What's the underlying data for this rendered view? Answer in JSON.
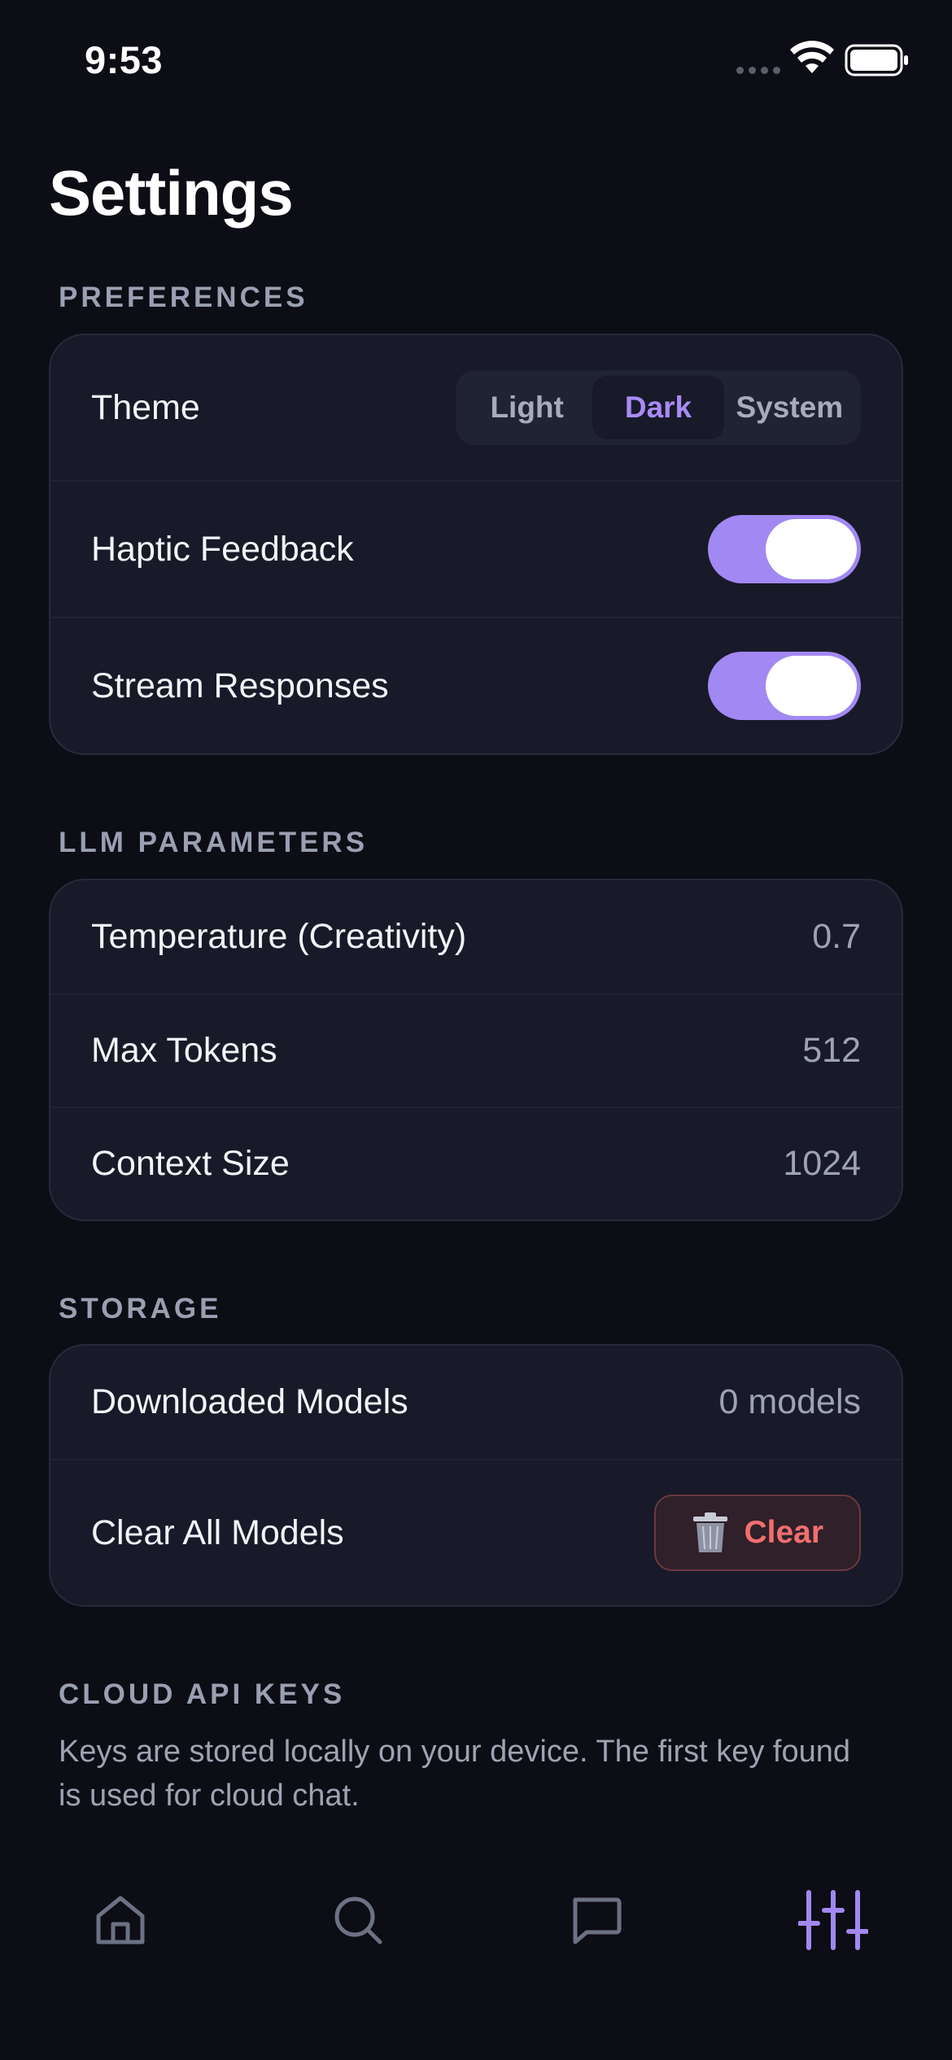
{
  "status_bar": {
    "time": "9:53"
  },
  "page": {
    "title": "Settings"
  },
  "preferences": {
    "section_label": "PREFERENCES",
    "theme": {
      "label": "Theme",
      "options": [
        "Light",
        "Dark",
        "System"
      ],
      "selected": "Dark"
    },
    "haptic_feedback": {
      "label": "Haptic Feedback",
      "enabled": true
    },
    "stream_responses": {
      "label": "Stream Responses",
      "enabled": true
    }
  },
  "llm_parameters": {
    "section_label": "LLM PARAMETERS",
    "rows": [
      {
        "label": "Temperature (Creativity)",
        "value": "0.7"
      },
      {
        "label": "Max Tokens",
        "value": "512"
      },
      {
        "label": "Context Size",
        "value": "1024"
      }
    ]
  },
  "storage": {
    "section_label": "STORAGE",
    "downloaded_models": {
      "label": "Downloaded Models",
      "value": "0 models"
    },
    "clear_all": {
      "label": "Clear All Models",
      "button_label": "Clear"
    }
  },
  "cloud_api_keys": {
    "section_label": "CLOUD API KEYS",
    "helper_text": "Keys are stored locally on your device. The first key found is used for cloud chat."
  },
  "tab_bar": {
    "tabs": [
      {
        "icon": "home-icon",
        "active": false
      },
      {
        "icon": "search-icon",
        "active": false
      },
      {
        "icon": "chat-icon",
        "active": false
      },
      {
        "icon": "sliders-icon",
        "active": true
      }
    ]
  },
  "colors": {
    "background": "#0c0d15",
    "card": "#181a29",
    "accent": "#a288f2",
    "danger": "#f26f6f",
    "muted_text": "#9ea3b3"
  }
}
